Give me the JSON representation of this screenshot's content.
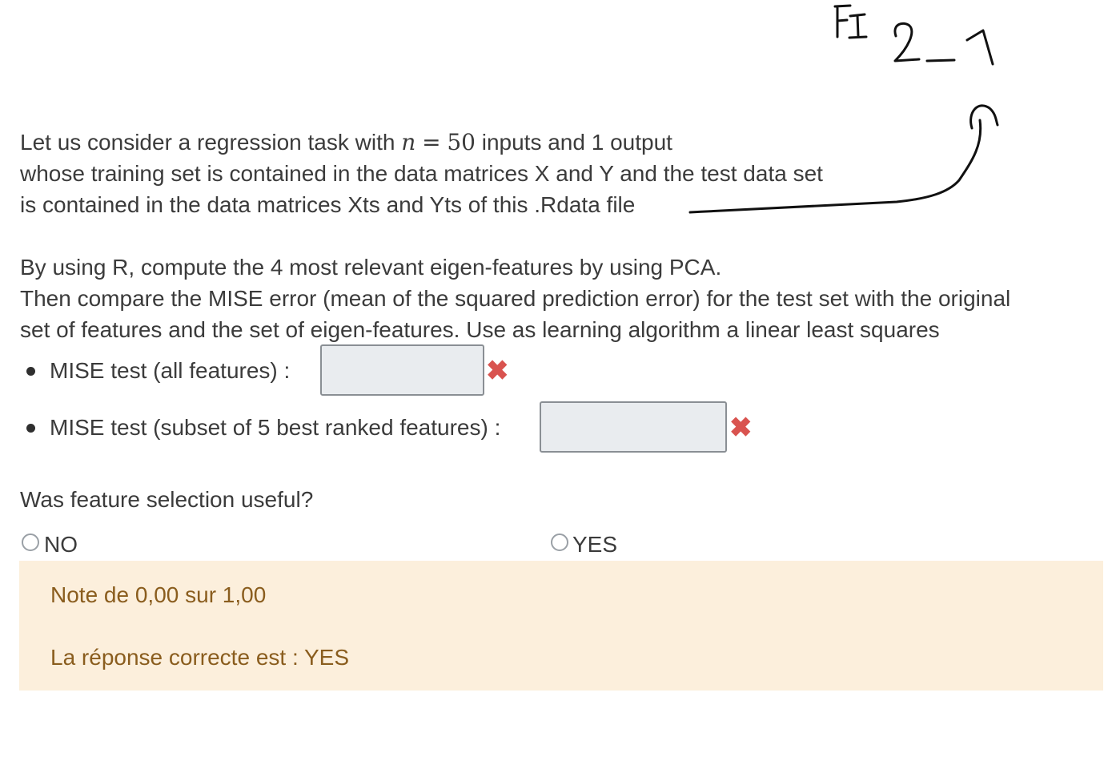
{
  "handwritten_note": "FI 2_1",
  "question": {
    "intro_line1_pre": "Let us consider a regression task with",
    "intro_math_var": "n",
    "intro_math_eq": "=",
    "intro_math_val": "50",
    "intro_line1_post": "inputs and 1 output",
    "intro_line2": "whose training set is contained in the data matrices X and Y  and the test data set",
    "intro_line3": "is contained in the data matrices Xts and Yts of this .Rdata file",
    "task_line1": "By using R,  compute the 4 most relevant eigen-features by using PCA.",
    "task_line2": "Then compare the MISE error (mean of the squared prediction error) for the test set with the original",
    "task_line3": "set of features and the set of eigen-features. Use as learning algorithm a linear least squares"
  },
  "answers": [
    {
      "label": "MISE test (all features) :",
      "value": "",
      "status": "incorrect"
    },
    {
      "label": "MISE test (subset of 5 best ranked features) :",
      "value": "",
      "status": "incorrect"
    }
  ],
  "selection_question": "Was feature selection useful?",
  "options": [
    {
      "label": "NO",
      "selected": false
    },
    {
      "label": "YES",
      "selected": false
    }
  ],
  "feedback": {
    "grade": "Note de 0,00 sur 1,00",
    "correct_answer": "La réponse correcte est : YES"
  },
  "colors": {
    "feedback_bg": "#fcefdc",
    "feedback_text": "#8a5d1e",
    "incorrect": "#d9534f",
    "input_bg": "#e9ecef"
  }
}
